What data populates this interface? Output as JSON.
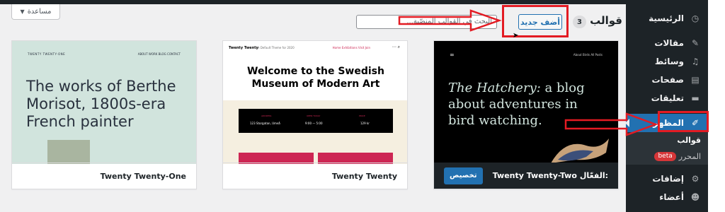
{
  "help": {
    "label": "مساعدة"
  },
  "header": {
    "title": "قوالب",
    "count": "3",
    "add_new": "أضف جديد",
    "search_placeholder": "البحث في القوالب المنصّبة..."
  },
  "sidebar": {
    "items": [
      {
        "label": "الرئيسية",
        "icon": "dashboard-icon"
      },
      {
        "label": "مقالات",
        "icon": "pin-icon"
      },
      {
        "label": "وسائط",
        "icon": "media-icon"
      },
      {
        "label": "صفحات",
        "icon": "page-icon"
      },
      {
        "label": "تعليقات",
        "icon": "comment-icon"
      },
      {
        "label": "المظهر",
        "icon": "brush-icon"
      },
      {
        "label": "إضافات",
        "icon": "plugin-icon"
      },
      {
        "label": "أعضاء",
        "icon": "user-icon"
      }
    ],
    "submenu": [
      {
        "label": "قوالب"
      },
      {
        "label": "المحرر",
        "badge": "beta"
      }
    ]
  },
  "themes": [
    {
      "name": "Twenty Twenty-Two",
      "active": true,
      "active_prefix": "الفعّال:",
      "customize_label": "تخصيص",
      "preview": {
        "headline_em": "The Hatchery:",
        "headline": "a blog about adventures in bird watching.",
        "nav": "About   Birds   All Posts"
      }
    },
    {
      "name": "Twenty Twenty",
      "active": false,
      "preview": {
        "site": "Twenty Twenty",
        "desc": "The Default Theme for 2020",
        "title": "Welcome to the Swedish Museum of Modern Art",
        "links": "Home   Exhibitions   Visit   Join",
        "info_labels": [
          "ADDRESS",
          "OPEN TODAY",
          "PRICE"
        ],
        "info_values": [
          "123 Storgatan, Umeå",
          "9:00 — 5:00",
          "129 kr"
        ]
      }
    },
    {
      "name": "Twenty Twenty-One",
      "active": false,
      "preview": {
        "site": "TWENTY TWENTY-ONE",
        "nav": "ABOUT   WORK   BLOG   CONTACT",
        "headline": "The works of Berthe Morisot, 1800s-era French painter"
      }
    }
  ],
  "colors": {
    "annotation": "#e31b23",
    "accent": "#2271b1",
    "sidebar_bg": "#1d2327"
  }
}
